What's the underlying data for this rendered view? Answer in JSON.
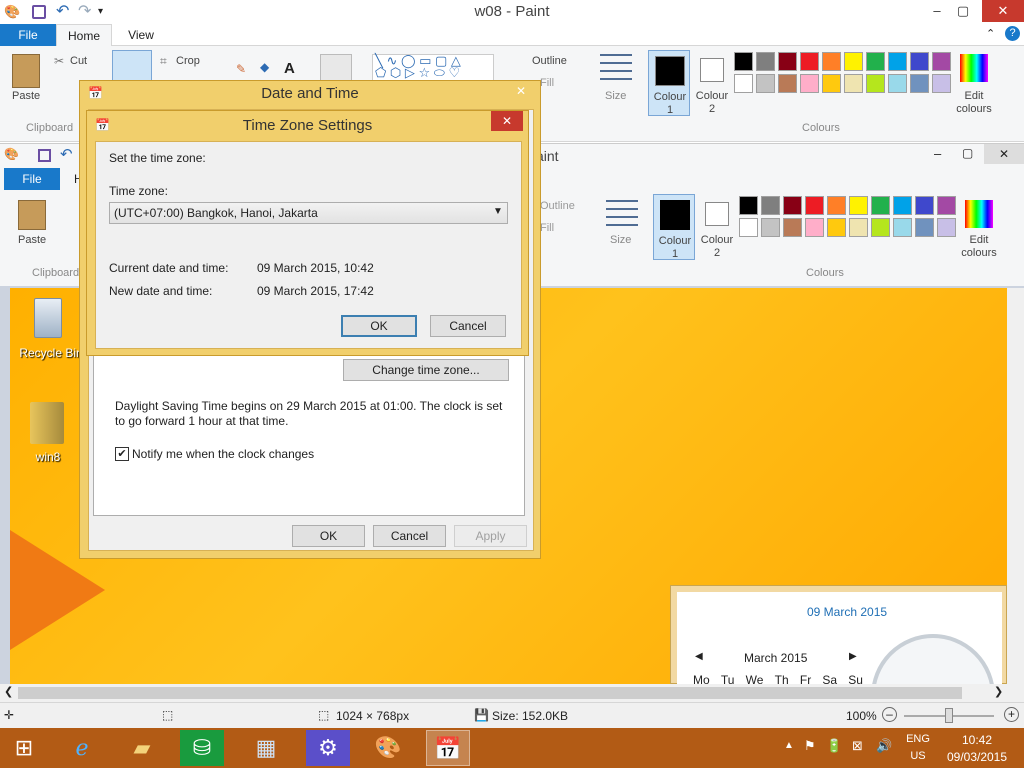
{
  "window": {
    "title": "w08 - Paint",
    "minimize": "–",
    "maximize": "▢",
    "close": "✕"
  },
  "ribbon": {
    "tabs": {
      "file": "File",
      "home": "Home",
      "view": "View"
    },
    "paste": "Paste",
    "cut": "Cut",
    "crop": "Crop",
    "clipboard_group": "Clipboard",
    "outline": "Outline",
    "fill": "Fill",
    "size": "Size",
    "colour1": "Colour\n1",
    "colour1_a": "Colour",
    "colour1_b": "1",
    "colour2_a": "Colour",
    "colour2_b": "2",
    "edit_colours_a": "Edit",
    "edit_colours_b": "colours",
    "colours_group": "Colours",
    "palette_row1": [
      "#000000",
      "#7f7f7f",
      "#880015",
      "#ed1c24",
      "#ff7f27",
      "#fff200",
      "#22b14c",
      "#00a2e8",
      "#3f48cc",
      "#a349a4"
    ],
    "palette_row2": [
      "#ffffff",
      "#c3c3c3",
      "#b97a57",
      "#ffaec9",
      "#ffc90e",
      "#efe4b0",
      "#b5e61d",
      "#99d9ea",
      "#7092be",
      "#c8bfe7"
    ]
  },
  "window2": {
    "title_fragment": "aint",
    "file_tab": "File",
    "tab_fragment": "H"
  },
  "datetime_dialog": {
    "title": "Date and Time",
    "change_tz_button": "Change time zone...",
    "dst_text": "Daylight Saving Time begins on 29 March 2015 at 01:00. The clock is set to go forward 1 hour at that time.",
    "notify_label": "Notify me when the clock changes",
    "notify_checked": true,
    "ok": "OK",
    "cancel": "Cancel",
    "apply": "Apply"
  },
  "tz_dialog": {
    "title": "Time Zone Settings",
    "set_label": "Set the time zone:",
    "tz_label": "Time zone:",
    "tz_value": "(UTC+07:00) Bangkok, Hanoi, Jakarta",
    "current_label": "Current date and time:",
    "current_value": "09 March 2015, 10:42",
    "new_label": "New date and time:",
    "new_value": "09 March 2015, 17:42",
    "ok": "OK",
    "cancel": "Cancel"
  },
  "desktop": {
    "icons": [
      {
        "label": "Recycle Bin"
      },
      {
        "label": "win8"
      }
    ],
    "calendar": {
      "date_heading": "09 March 2015",
      "month": "March 2015",
      "weekdays": [
        "Mo",
        "Tu",
        "We",
        "Th",
        "Fr",
        "Sa",
        "Su"
      ]
    }
  },
  "status": {
    "dimensions": "1024 × 768px",
    "size": "Size: 152.0KB",
    "zoom": "100%"
  },
  "taskbar": {
    "lang": "ENG",
    "region": "US",
    "time": "10:42",
    "date": "09/03/2015"
  }
}
